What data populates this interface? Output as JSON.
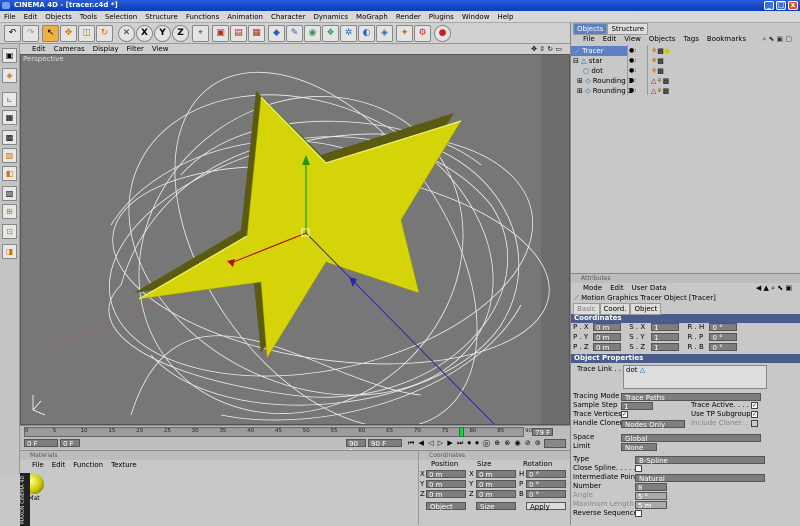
{
  "window": {
    "app": "CINEMA 4D",
    "title": "CINEMA 4D - [tracer.c4d *]"
  },
  "menu": [
    "File",
    "Edit",
    "Objects",
    "Tools",
    "Selection",
    "Structure",
    "Functions",
    "Animation",
    "Character",
    "Dynamics",
    "MoGraph",
    "Render",
    "Plugins",
    "Window",
    "Help"
  ],
  "viewport": {
    "menu": [
      "Edit",
      "Cameras",
      "Display",
      "Filter",
      "View"
    ],
    "label": "Perspective"
  },
  "timeline": {
    "ticks": [
      "0",
      "5",
      "10",
      "15",
      "20",
      "25",
      "30",
      "35",
      "40",
      "45",
      "50",
      "55",
      "60",
      "65",
      "70",
      "75",
      "80",
      "85",
      "90"
    ],
    "current_frame": "79 F",
    "start": "0 F",
    "min": "0 F",
    "max": "90 F",
    "end": "90 F",
    "playhead_fraction": 0.87
  },
  "materials": {
    "header": "Materials",
    "menu": [
      "File",
      "Edit",
      "Function",
      "Texture"
    ],
    "items": [
      {
        "name": "Mat"
      }
    ]
  },
  "coordinates_panel": {
    "header": "Coordinates",
    "columns": [
      "Position",
      "Size",
      "Rotation"
    ],
    "rows": [
      {
        "axis": "X",
        "pos": "0 m",
        "size_axis": "X",
        "size": "0 m",
        "rot_axis": "H",
        "rot": "0 °"
      },
      {
        "axis": "Y",
        "pos": "0 m",
        "size_axis": "Y",
        "size": "0 m",
        "rot_axis": "P",
        "rot": "0 °"
      },
      {
        "axis": "Z",
        "pos": "0 m",
        "size_axis": "Z",
        "size": "0 m",
        "rot_axis": "B",
        "rot": "0 °"
      }
    ],
    "mode": "Object",
    "size_mode": "Size",
    "apply": "Apply"
  },
  "objects_panel": {
    "tabs": [
      "Objects",
      "Structure"
    ],
    "menu": [
      "File",
      "Edit",
      "View",
      "Objects",
      "Tags",
      "Bookmarks"
    ],
    "items": [
      {
        "name": "Tracer",
        "indent": 0,
        "selected": true
      },
      {
        "name": "star",
        "indent": 0,
        "selected": false
      },
      {
        "name": "dot",
        "indent": 1,
        "selected": false
      },
      {
        "name": "Rounding 1",
        "indent": 1,
        "selected": false
      },
      {
        "name": "Rounding 2",
        "indent": 1,
        "selected": false
      }
    ]
  },
  "attributes": {
    "header": "Attributes",
    "menu": [
      "Mode",
      "Edit",
      "User Data"
    ],
    "object_title": "Motion Graphics Tracer Object [Tracer]",
    "tabs": [
      "Basic",
      "Coord.",
      "Object"
    ],
    "coordinates_title": "Coordinates",
    "coords": [
      {
        "p": "P . X",
        "pv": "0 m",
        "s": "S . X",
        "sv": "1",
        "r": "R . H",
        "rv": "0 °"
      },
      {
        "p": "P . Y",
        "pv": "0 m",
        "s": "S . Y",
        "sv": "1",
        "r": "R . P",
        "rv": "0 °"
      },
      {
        "p": "P . Z",
        "pv": "0 m",
        "s": "S . Z",
        "sv": "1",
        "r": "R . B",
        "rv": "0 °"
      }
    ],
    "object_properties_title": "Object Properties",
    "trace_link_label": "Trace Link . .",
    "trace_link_value": "dot",
    "tracing_mode_label": "Tracing Mode",
    "tracing_mode_value": "Trace Paths",
    "trace_active_label": "Trace Active. . . .",
    "sample_step_label": "Sample Step",
    "sample_step_value": "1",
    "use_tp_label": "Use TP Subgroups",
    "trace_vertices_label": "Trace Vertices",
    "handle_cloners_label": "Handle Cloners",
    "handle_cloners_value": "Nodes Only",
    "include_cloner_label": "Include Cloner. . .",
    "space_label": "Space",
    "space_value": "Global",
    "limit_label": "Limit",
    "limit_value": "None",
    "type_label": "Type",
    "type_value": "B-Spline",
    "close_spline_label": "Close Spline. . . . .",
    "intermediate_label": "Intermediate Points",
    "intermediate_value": "Natural",
    "number_label": "Number",
    "number_value": "8",
    "angle_label": "Angle",
    "angle_value": "5 °",
    "max_length_label": "Maximum Length",
    "max_length_value": "5 m",
    "reverse_label": "Reverse Sequence"
  },
  "brand": "MAXON CINEMA 4D"
}
